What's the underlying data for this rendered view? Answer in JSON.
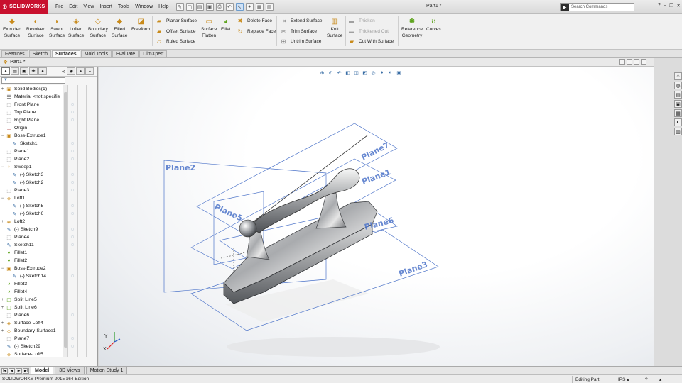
{
  "app": {
    "logo_text": "SOLIDWORKS",
    "doc_title": "Part1 *",
    "menu": [
      "File",
      "Edit",
      "View",
      "Insert",
      "Tools",
      "Window",
      "Help"
    ],
    "search_placeholder": "Search Commands"
  },
  "ribbon": {
    "big_buttons": [
      {
        "line1": "Extruded",
        "line2": "Surface",
        "icon": "extruded-surface-icon"
      },
      {
        "line1": "Revolved",
        "line2": "Surface",
        "icon": "revolved-surface-icon"
      },
      {
        "line1": "Swept",
        "line2": "Surface",
        "icon": "swept-surface-icon"
      },
      {
        "line1": "Lofted",
        "line2": "Surface",
        "icon": "lofted-surface-icon"
      },
      {
        "line1": "Boundary",
        "line2": "Surface",
        "icon": "boundary-surface-icon"
      },
      {
        "line1": "Filled",
        "line2": "Surface",
        "icon": "filled-surface-icon"
      },
      {
        "line1": "Freeform",
        "line2": "",
        "icon": "freeform-icon"
      }
    ],
    "col1": [
      "Planar Surface",
      "Offset Surface",
      "Ruled Surface"
    ],
    "flatten": {
      "line1": "Surface",
      "line2": "Flatten"
    },
    "fillet": "Fillet",
    "col2": [
      "Delete Face",
      "Replace Face"
    ],
    "col3": [
      "Extend Surface",
      "Trim Surface",
      "Untrim Surface"
    ],
    "knit": {
      "line1": "Knit",
      "line2": "Surface"
    },
    "col4": [
      "Thicken",
      "Thickened Cut",
      "Cut With Surface"
    ],
    "reference": {
      "line1": "Reference",
      "line2": "Geometry"
    },
    "curves": "Curves"
  },
  "tabs": [
    "Features",
    "Sketch",
    "Surfaces",
    "Mold Tools",
    "Evaluate",
    "DimXpert"
  ],
  "active_tab": "Surfaces",
  "document": {
    "tab_title": "Part1 *"
  },
  "tree": {
    "items": [
      {
        "label": "Solid Bodies(1)",
        "icon": "folder-icon",
        "expand": "+"
      },
      {
        "label": "Material <not specifie",
        "icon": "material-icon",
        "expand": ""
      },
      {
        "label": "Front Plane",
        "icon": "plane-icon",
        "expand": ""
      },
      {
        "label": "Top Plane",
        "icon": "plane-icon",
        "expand": ""
      },
      {
        "label": "Right Plane",
        "icon": "plane-icon",
        "expand": ""
      },
      {
        "label": "Origin",
        "icon": "origin-icon",
        "expand": ""
      },
      {
        "label": "Boss-Extrude1",
        "icon": "extrude-icon",
        "expand": "−"
      },
      {
        "label": "Sketch1",
        "icon": "sketch-icon",
        "expand": "",
        "indent": 1
      },
      {
        "label": "Plane1",
        "icon": "plane-icon",
        "expand": ""
      },
      {
        "label": "Plane2",
        "icon": "plane-icon",
        "expand": ""
      },
      {
        "label": "Sweep1",
        "icon": "sweep-icon",
        "expand": "−"
      },
      {
        "label": "(-) Sketch3",
        "icon": "sketch-icon",
        "expand": "",
        "indent": 1
      },
      {
        "label": "(-) Sketch2",
        "icon": "sketch-icon",
        "expand": "",
        "indent": 1
      },
      {
        "label": "Plane3",
        "icon": "plane-icon",
        "expand": ""
      },
      {
        "label": "Loft1",
        "icon": "loft-icon",
        "expand": "−"
      },
      {
        "label": "(-) Sketch5",
        "icon": "sketch-icon",
        "expand": "",
        "indent": 1
      },
      {
        "label": "(-) Sketch6",
        "icon": "sketch-icon",
        "expand": "",
        "indent": 1
      },
      {
        "label": "Loft2",
        "icon": "loft-icon",
        "expand": "+"
      },
      {
        "label": "(-) Sketch9",
        "icon": "sketch-icon",
        "expand": ""
      },
      {
        "label": "Plane4",
        "icon": "plane-icon",
        "expand": ""
      },
      {
        "label": "Sketch11",
        "icon": "sketch-icon",
        "expand": ""
      },
      {
        "label": "Fillet1",
        "icon": "fillet-icon",
        "expand": ""
      },
      {
        "label": "Fillet2",
        "icon": "fillet-icon",
        "expand": ""
      },
      {
        "label": "Boss-Extrude2",
        "icon": "extrude-icon",
        "expand": "−"
      },
      {
        "label": "(-) Sketch14",
        "icon": "sketch-icon",
        "expand": "",
        "indent": 1
      },
      {
        "label": "Fillet3",
        "icon": "fillet-icon",
        "expand": ""
      },
      {
        "label": "Fillet4",
        "icon": "fillet-icon",
        "expand": ""
      },
      {
        "label": "Split Line5",
        "icon": "split-line-icon",
        "expand": "+"
      },
      {
        "label": "Split Line6",
        "icon": "split-line-icon",
        "expand": "+"
      },
      {
        "label": "Plane6",
        "icon": "plane-icon",
        "expand": ""
      },
      {
        "label": "Surface-Loft4",
        "icon": "surface-loft-icon",
        "expand": "+"
      },
      {
        "label": "Boundary-Surface1",
        "icon": "boundary-surface-icon",
        "expand": "+"
      },
      {
        "label": "Plane7",
        "icon": "plane-icon",
        "expand": ""
      },
      {
        "label": "(-) Sketch29",
        "icon": "sketch-icon",
        "expand": ""
      },
      {
        "label": "Surface-Loft5",
        "icon": "surface-loft-icon",
        "expand": ""
      }
    ]
  },
  "viewport": {
    "plane_labels": [
      "Plane2",
      "Plane7",
      "Plane1",
      "Plane5",
      "Plane6",
      "Plane3"
    ],
    "triad": {
      "y": "Y",
      "x": "X"
    }
  },
  "bottom_tabs": [
    "Model",
    "3D Views",
    "Motion Study 1"
  ],
  "status": {
    "product": "SOLIDWORKS Premium 2015 x64 Edition",
    "mode": "Editing Part",
    "units": "IPS"
  },
  "colors": {
    "brand": "#c8102e",
    "plane": "#4d74c9",
    "accent": "#3a6ea5"
  }
}
